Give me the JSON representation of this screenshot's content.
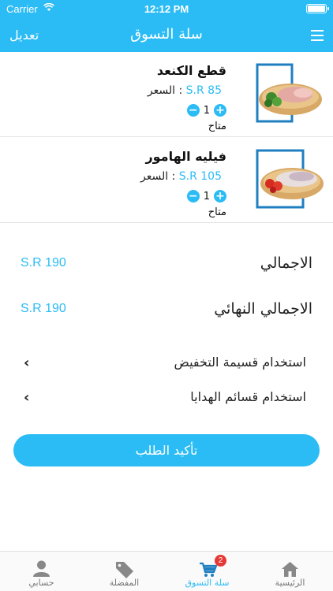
{
  "status_bar": {
    "carrier": "Carrier",
    "time": "12:12 PM",
    "battery_level": 1.0
  },
  "header": {
    "edit_label": "تعديل",
    "title": "سلة التسوق",
    "menu_icon": "hamburger-menu-icon"
  },
  "cart_items": [
    {
      "name": "قطع الكنعد",
      "price_label": "السعر :",
      "price": "S.R 85",
      "quantity": "1",
      "availability": "متاح",
      "image_icon": "fish-fillet-herbs-image"
    },
    {
      "name": "فيليه الهامور",
      "price_label": "السعر :",
      "price": "S.R 105",
      "quantity": "1",
      "availability": "متاح",
      "image_icon": "fish-fillet-tomato-image"
    }
  ],
  "totals": {
    "total_label": "الاجمالي",
    "total_value": "S.R 190",
    "final_label": "الاجمالي النهائي",
    "final_value": "S.R 190"
  },
  "options": {
    "coupon_label": "استخدام قسيمة التخفيض",
    "gift_label": "استخدام قسائم الهدايا"
  },
  "confirm_label": "تأكيد الطلب",
  "tabbar": {
    "home": "الرئيسية",
    "cart": "سلة التسوق",
    "cart_badge": "2",
    "favorites": "المفضلة",
    "account": "حسابي"
  },
  "colors": {
    "accent": "#2bbcf5",
    "badge": "#e53935"
  }
}
